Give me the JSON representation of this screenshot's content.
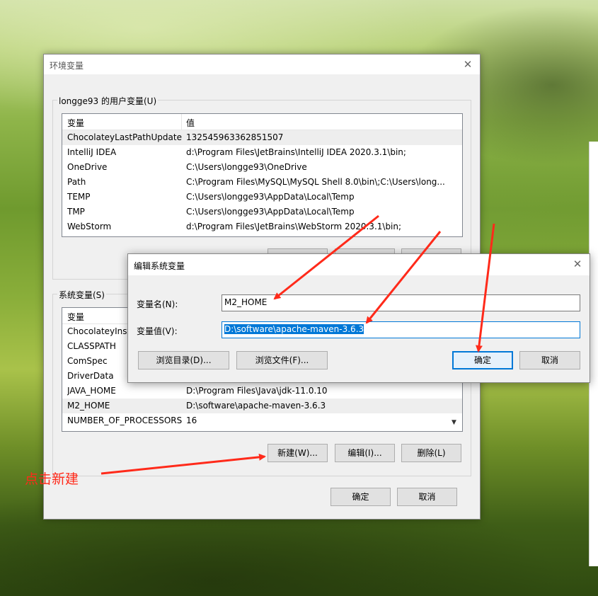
{
  "env_dialog": {
    "title": "环境变量",
    "user_group_label": "longge93 的用户变量(U)",
    "user_columns": [
      "变量",
      "值"
    ],
    "user_vars": [
      {
        "name": "ChocolateyLastPathUpdate",
        "value": "132545963362851507"
      },
      {
        "name": "IntelliJ IDEA",
        "value": "d:\\Program Files\\JetBrains\\IntelliJ IDEA 2020.3.1\\bin;"
      },
      {
        "name": "OneDrive",
        "value": "C:\\Users\\longge93\\OneDrive"
      },
      {
        "name": "Path",
        "value": "C:\\Program Files\\MySQL\\MySQL Shell 8.0\\bin\\;C:\\Users\\long..."
      },
      {
        "name": "TEMP",
        "value": "C:\\Users\\longge93\\AppData\\Local\\Temp"
      },
      {
        "name": "TMP",
        "value": "C:\\Users\\longge93\\AppData\\Local\\Temp"
      },
      {
        "name": "WebStorm",
        "value": "d:\\Program Files\\JetBrains\\WebStorm 2020.3.1\\bin;"
      }
    ],
    "system_group_label": "系统变量(S)",
    "system_columns": [
      "变量",
      "值"
    ],
    "system_vars": [
      {
        "name": "ChocolateyInsta",
        "value": ""
      },
      {
        "name": "CLASSPATH",
        "value": ""
      },
      {
        "name": "ComSpec",
        "value": ""
      },
      {
        "name": "DriverData",
        "value": ""
      },
      {
        "name": "JAVA_HOME",
        "value": "D:\\Program Files\\Java\\jdk-11.0.10"
      },
      {
        "name": "M2_HOME",
        "value": "D:\\software\\apache-maven-3.6.3"
      },
      {
        "name": "NUMBER_OF_PROCESSORS",
        "value": "16"
      }
    ],
    "new_button": "新建(W)...",
    "edit_button": "编辑(I)...",
    "delete_button": "删除(L)",
    "ok_button": "确定",
    "cancel_button": "取消"
  },
  "edit_dialog": {
    "title": "编辑系统变量",
    "name_label": "变量名(N):",
    "name_value": "M2_HOME",
    "value_label": "变量值(V):",
    "value_value": "D:\\software\\apache-maven-3.6.3",
    "browse_dir_button": "浏览目录(D)...",
    "browse_file_button": "浏览文件(F)...",
    "ok_button": "确定",
    "cancel_button": "取消"
  },
  "annotation": {
    "text": "点击新建",
    "color": "#ff2a1a"
  }
}
